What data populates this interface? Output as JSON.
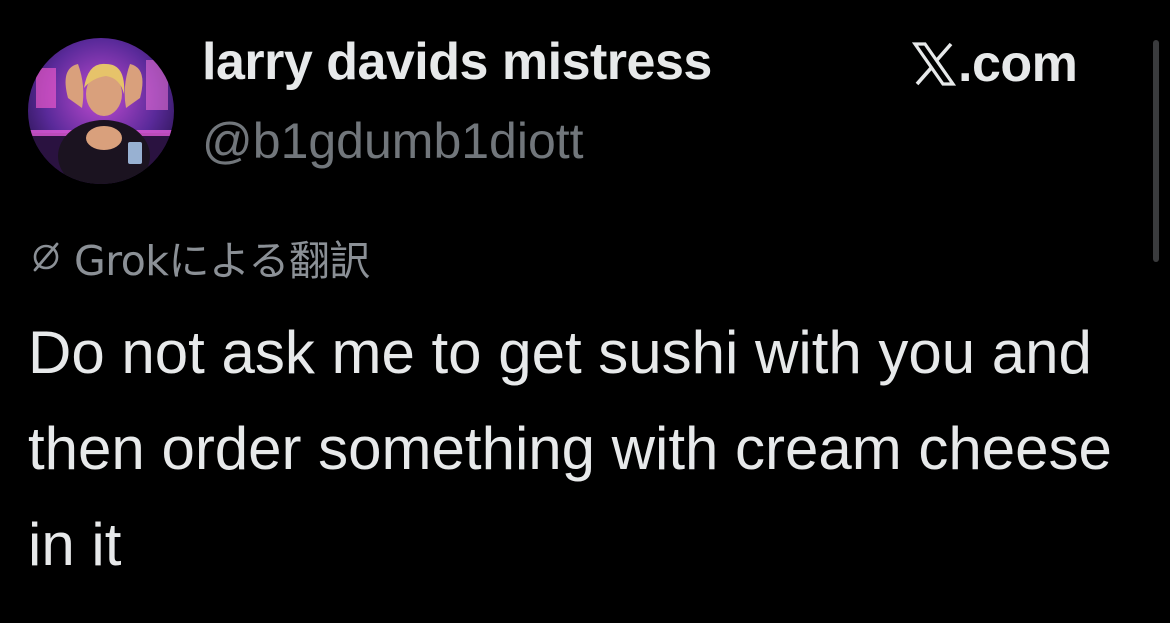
{
  "author": {
    "display_name": "larry davids mistress",
    "handle": "@b1gdumb1diott",
    "avatar_icon": "profile-photo"
  },
  "brand": {
    "icon": "x-logo-icon",
    "label": ".com"
  },
  "translation": {
    "icon": "grok-icon",
    "label": "Grokによる翻訳"
  },
  "tweet": {
    "text": "Do not ask me to get sushi with you and then order something with cream cheese in it"
  },
  "colors": {
    "background": "#000000",
    "primary_text": "#e7e9ea",
    "secondary_text": "#71767b"
  }
}
